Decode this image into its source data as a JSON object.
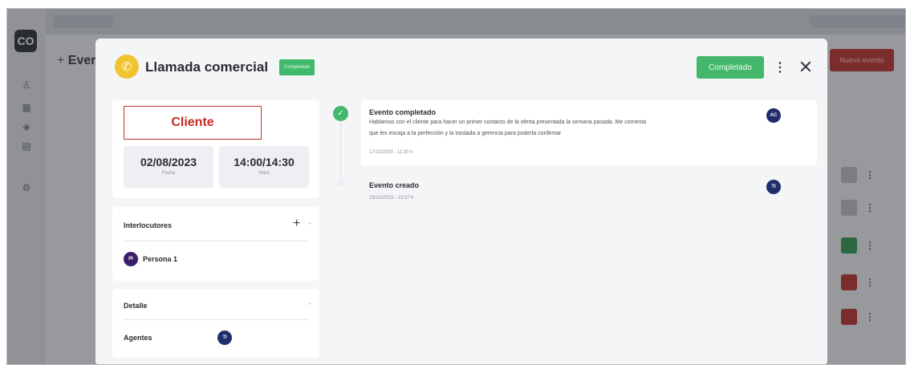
{
  "background": {
    "title": "Ever",
    "new_event_button": "Nuevo evento",
    "logo": "CO",
    "sidebar_icons": [
      "users-icon",
      "document-icon",
      "cube-icon",
      "file-icon",
      "settings-icon"
    ]
  },
  "modal": {
    "title": "Llamada comercial",
    "status_chip": "Completado",
    "complete_button": "Completado",
    "client_label": "Cliente",
    "date": {
      "value": "02/08/2023",
      "label": "Fecha"
    },
    "time": {
      "value": "14:00/14:30",
      "label": "Hora"
    },
    "interlocutores": {
      "title": "Interlocutores",
      "persons": [
        {
          "initials": "PI",
          "name": "Persona 1"
        }
      ]
    },
    "detalle": {
      "title": "Detalle",
      "agents_label": "Agentes",
      "agent_initials": "TI"
    },
    "timeline": [
      {
        "title": "Evento completado",
        "body_line1": "Hablamos con el cliente para hacer un primer contacto de la oferta presentada la semana pasada. Me comenta",
        "body_line2": "que les encaja a la perfección y la traslada a gerencia para poderla confirmar",
        "time": "17/11/2023 - 11:30 h",
        "initials": "AC"
      },
      {
        "title": "Evento creado",
        "time": "23/10/2023 - 13:57 h",
        "initials": "TI"
      }
    ]
  },
  "colors": {
    "accent_green": "#43b86a",
    "brand_red": "#c0302b",
    "phone_yellow": "#f2c330",
    "avatar_navy": "#1f2d6b",
    "avatar_purple": "#3b1f6b"
  }
}
